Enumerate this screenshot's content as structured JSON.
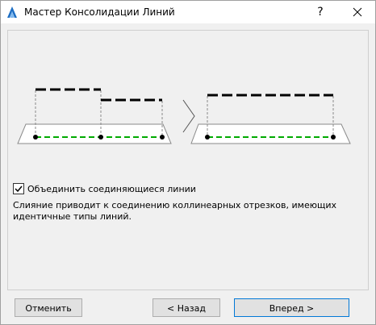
{
  "window": {
    "title": "Мастер Консолидации Линий",
    "help_label": "?",
    "app_icon": "archicad-logo-icon",
    "close_icon": "close-icon"
  },
  "options": {
    "merge_checkbox_label": "Объединить соединяющиеся линии",
    "merge_checked": true,
    "description": "Слияние приводит к соединению коллинеарных отрезков, имеющих идентичные типы линий."
  },
  "buttons": {
    "cancel": "Отменить",
    "back": "< Назад",
    "next": "Вперед >"
  },
  "colors": {
    "accent": "#0078d7",
    "guide_line": "#00aa00",
    "app_icon": "#1e6fc4"
  }
}
